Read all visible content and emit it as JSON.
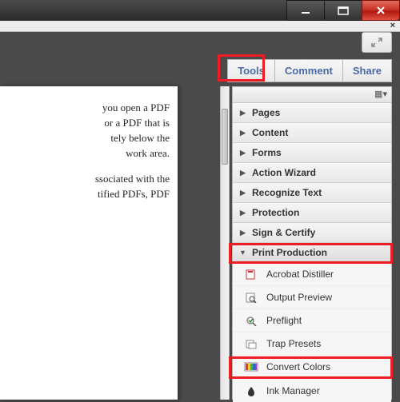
{
  "window": {
    "close_x_text": "×"
  },
  "tabs": {
    "tools": "Tools",
    "comment": "Comment",
    "share": "Share"
  },
  "document": {
    "para1_l1": "you open a PDF",
    "para1_l2": "or a PDF that is",
    "para1_l3": "tely below the",
    "para1_l4": "work area.",
    "para2_l1": "ssociated with the",
    "para2_l2": "tified PDFs, PDF"
  },
  "sidebar": {
    "groups": {
      "pages": "Pages",
      "content": "Content",
      "forms": "Forms",
      "action_wizard": "Action Wizard",
      "recognize_text": "Recognize Text",
      "protection": "Protection",
      "sign_certify": "Sign & Certify",
      "print_production": "Print Production"
    },
    "items": {
      "acrobat_distiller": "Acrobat Distiller",
      "output_preview": "Output Preview",
      "preflight": "Preflight",
      "trap_presets": "Trap Presets",
      "convert_colors": "Convert Colors",
      "ink_manager": "Ink Manager"
    }
  }
}
